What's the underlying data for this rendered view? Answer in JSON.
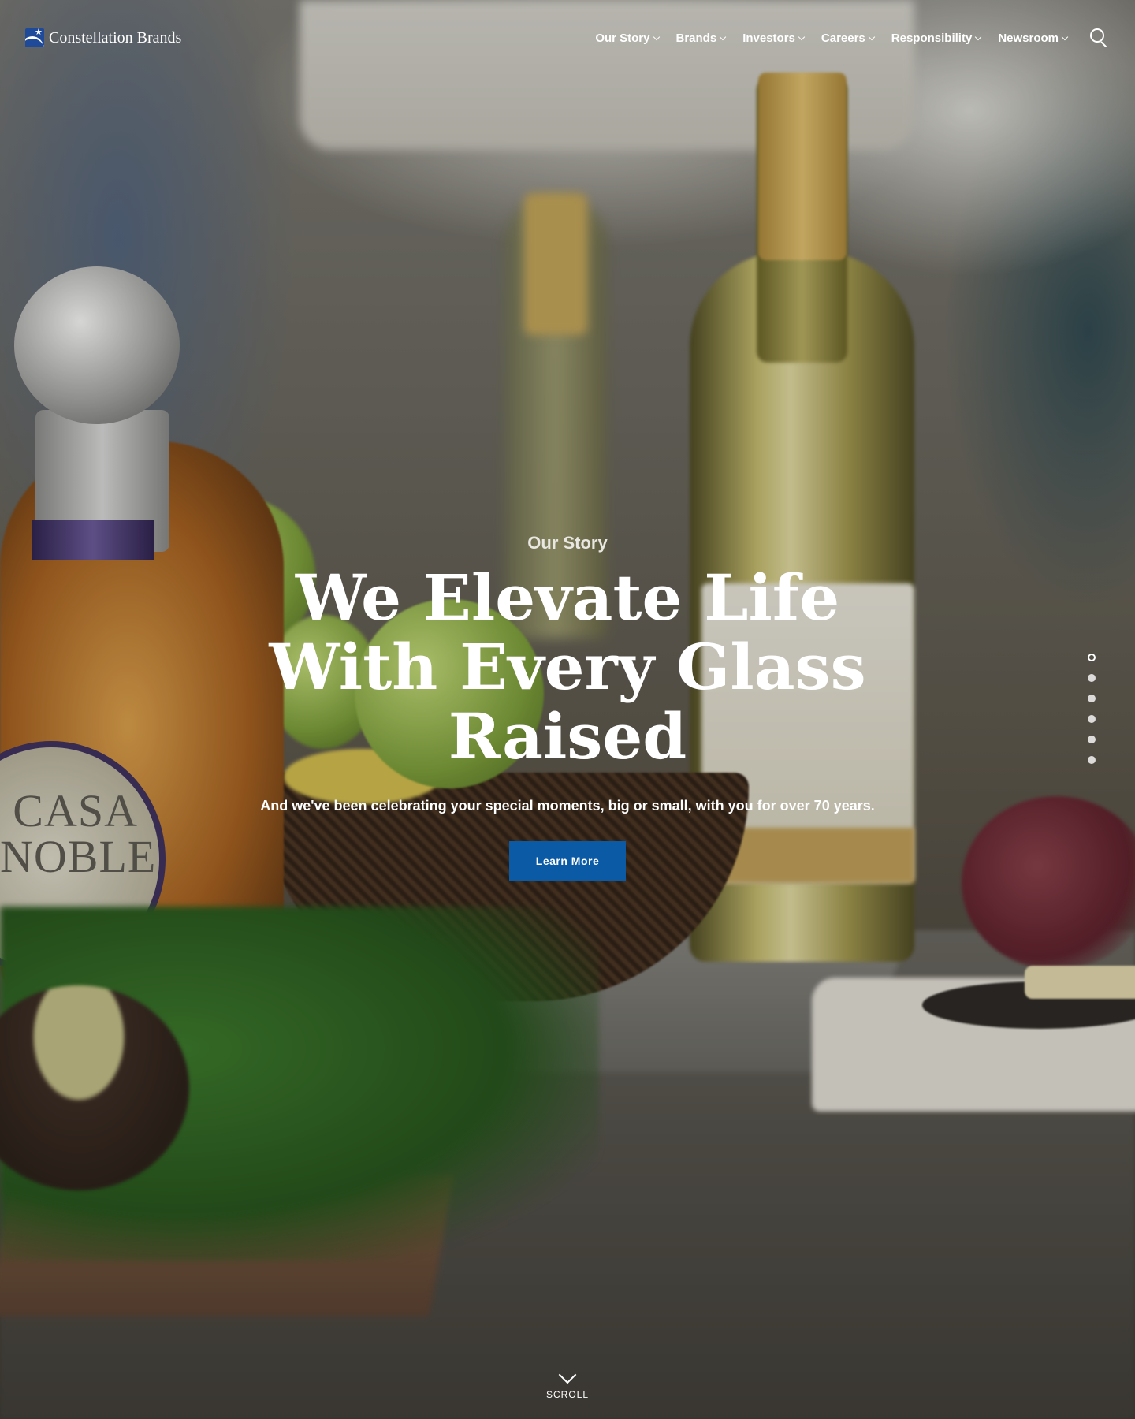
{
  "brand": {
    "name": "Constellation Brands"
  },
  "nav": {
    "items": [
      {
        "label": "Our Story"
      },
      {
        "label": "Brands"
      },
      {
        "label": "Investors"
      },
      {
        "label": "Careers"
      },
      {
        "label": "Responsibility"
      },
      {
        "label": "Newsroom"
      }
    ],
    "search_icon": "search-icon"
  },
  "hero": {
    "eyebrow": "Our Story",
    "headline": "We Elevate Life With Every Glass Raised",
    "subline": "And we've been celebrating your special moments, big or small, with you for over 70 years.",
    "cta_label": "Learn More",
    "cta_color": "#0a5aa6",
    "background_bottle_label": "CASA NOBLE"
  },
  "pagination": {
    "total": 6,
    "active": 1
  },
  "scroll": {
    "label": "SCROLL"
  }
}
